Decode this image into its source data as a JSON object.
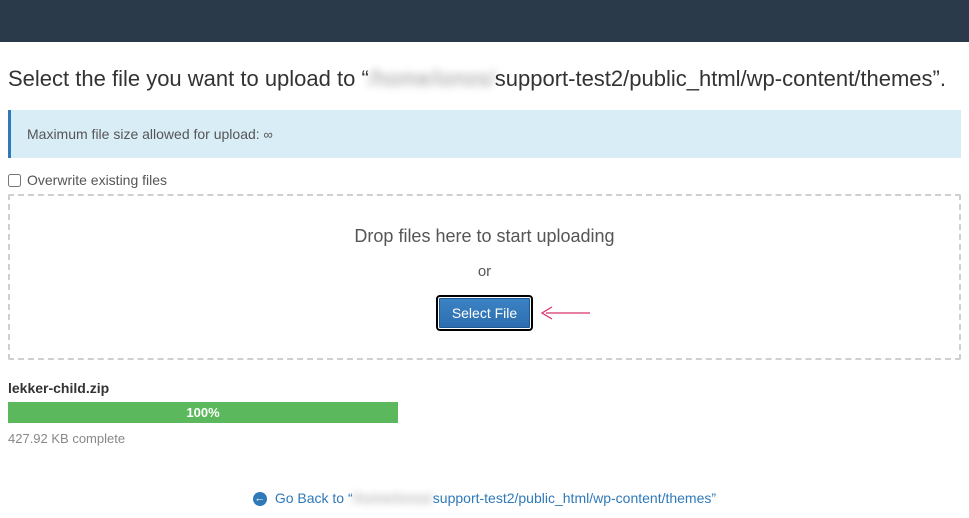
{
  "header_title_prefix": "Select the file you want to upload to “",
  "header_title_blurred": "/home/ionos/",
  "header_title_path": "support-test2/public_html/wp-content/themes",
  "header_title_suffix": "”.",
  "info_callout": {
    "label": "Maximum file size allowed for upload: ",
    "value": "∞"
  },
  "overwrite_checkbox_label": "Overwrite existing files",
  "dropzone": {
    "drop_message": "Drop files here to start uploading",
    "or_text": "or",
    "select_file_label": "Select File"
  },
  "upload": {
    "file_name": "lekker-child.zip",
    "progress_percent": "100%",
    "complete_text": "427.92 KB complete"
  },
  "goback": {
    "prefix": "Go Back to “",
    "blurred": "/home/ionos/",
    "path": "support-test2/public_html/wp-content/themes",
    "suffix": "”"
  },
  "colors": {
    "accent": "#2f79b9",
    "topbar": "#2b3a4a",
    "callout_bg": "#d9edf7",
    "progress": "#5cb85c"
  }
}
